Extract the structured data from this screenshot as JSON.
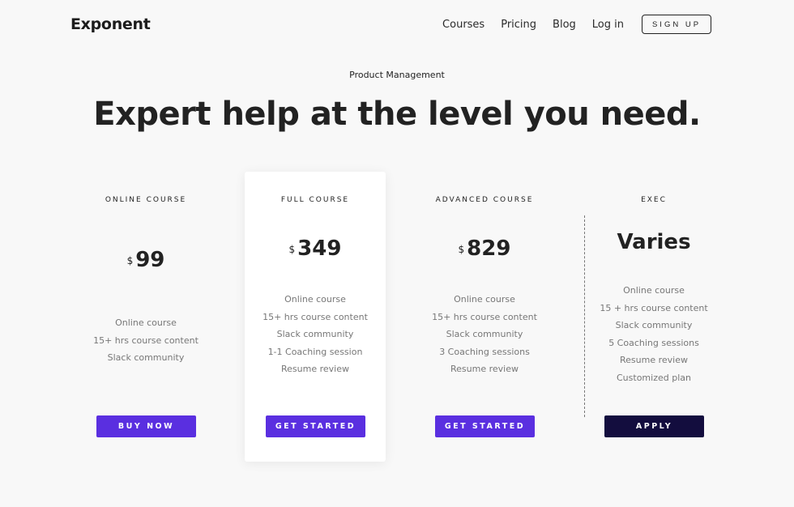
{
  "nav": {
    "logo": "Exponent",
    "links": [
      "Courses",
      "Pricing",
      "Blog",
      "Log in"
    ],
    "signup_label": "SIGN UP"
  },
  "hero": {
    "eyebrow": "Product Management",
    "headline": "Expert help at the level you need."
  },
  "plans": [
    {
      "name": "ONLINE COURSE",
      "currency": "$",
      "price": "99",
      "features": [
        "Online course",
        "15+ hrs course content",
        "Slack community"
      ],
      "button": "BUY NOW"
    },
    {
      "name": "FULL COURSE",
      "currency": "$",
      "price": "349",
      "features": [
        "Online course",
        "15+ hrs course content",
        "Slack community",
        "1-1 Coaching session",
        "Resume review"
      ],
      "button": "GET STARTED"
    },
    {
      "name": "ADVANCED COURSE",
      "currency": "$",
      "price": "829",
      "features": [
        "Online course",
        "15+ hrs course content",
        "Slack community",
        "3 Coaching sessions",
        "Resume review"
      ],
      "button": "GET STARTED"
    },
    {
      "name": "EXEC",
      "price": "Varies",
      "features": [
        "Online course",
        "15 + hrs course content",
        "Slack community",
        "5 Coaching sessions",
        "Resume review",
        "Customized plan"
      ],
      "button": "APPLY"
    }
  ],
  "colors": {
    "accent": "#5a2fe0",
    "exec_button": "#130d3e",
    "background": "#f8f8f8"
  }
}
